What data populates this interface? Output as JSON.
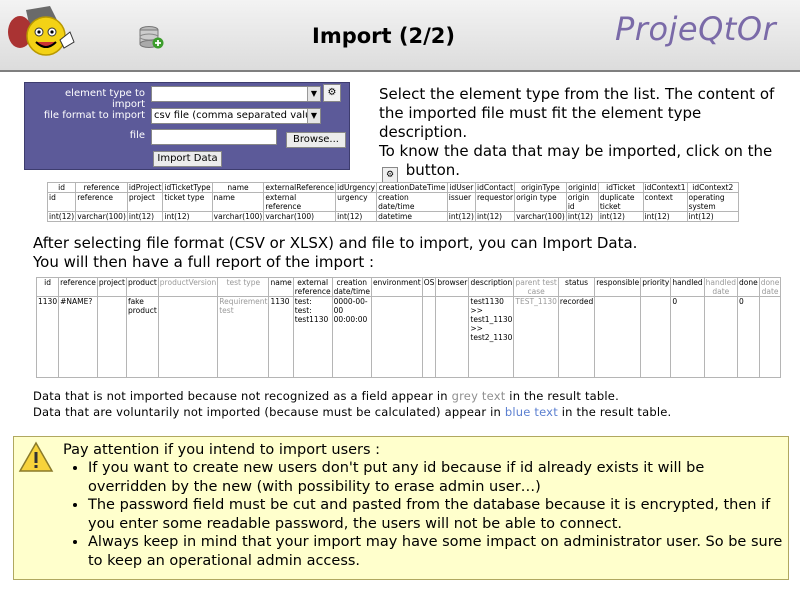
{
  "header": {
    "title": "Import (2/2)",
    "brand": "ProjeQtOr"
  },
  "form": {
    "element_label": "element type to import",
    "element_value": "",
    "format_label": "file format to import",
    "format_value": "csv file (comma separated valu",
    "file_label": "file",
    "browse_label": "Browse...",
    "import_label": "Import Data"
  },
  "description": {
    "line1": "Select the element type from the list. The content of the imported file must fit the element type description.",
    "line2_pre": "To know the data that may be imported, click on the",
    "line2_post": "button."
  },
  "type_table": {
    "columns": [
      "id",
      "reference",
      "idProject",
      "idTicketType",
      "name",
      "externalReference",
      "idUrgency",
      "creationDateTime",
      "idUser",
      "idContact",
      "originType",
      "originId",
      "idTicket",
      "idContext1",
      "idContext2"
    ],
    "labels": [
      "id",
      "reference",
      "project",
      "ticket type",
      "name",
      "external reference",
      "urgency",
      "creation date/time",
      "issuer",
      "requestor",
      "origin type",
      "origin id",
      "duplicate ticket",
      "context",
      "operating system"
    ],
    "types": [
      "int(12)",
      "varchar(100)",
      "int(12)",
      "int(12)",
      "varchar(100)",
      "varchar(100)",
      "int(12)",
      "datetime",
      "int(12)",
      "int(12)",
      "varchar(100)",
      "int(12)",
      "int(12)",
      "int(12)",
      "int(12)"
    ]
  },
  "middle_text": {
    "line1": "After selecting file format (CSV or XLSX) and file to import, you can Import Data.",
    "line2": "You will then have a full report of the import :"
  },
  "result_table": {
    "columns": [
      "id",
      "reference",
      "project",
      "product",
      "productVersion",
      "test type",
      "name",
      "external reference",
      "creation date/time",
      "environment",
      "OS",
      "browser",
      "description",
      "parent test case",
      "status",
      "responsible",
      "priority",
      "handled",
      "handled date",
      "done",
      "done date"
    ],
    "grey_columns": [
      4,
      5,
      13,
      18,
      20
    ],
    "row": [
      "1130",
      "#NAME?",
      "",
      "fake product",
      "",
      "Requirement test",
      "1130",
      "test: test: test1130",
      "0000-00-00 00:00:00",
      "",
      "",
      "",
      "test1130 >> test1_1130 >> test2_1130",
      "TEST_1130",
      "recorded",
      "",
      "",
      "0",
      "",
      "0",
      ""
    ]
  },
  "notes": {
    "grey_pre": "Data that is not imported because not recognized as a field appear in",
    "grey_word": "grey text",
    "grey_post": "in the result table.",
    "blue_pre": "Data that are voluntarily not imported (because must be calculated) appear in",
    "blue_word": "blue text",
    "blue_post": "in the result table."
  },
  "warning": {
    "title": "Pay attention if you intend to import users :",
    "items": [
      "If you want to create new users don't put any id because if id already exists it will be overridden by the new (with possibility to erase admin user…)",
      "The password field must be cut and pasted from the database because it is encrypted, then if you enter some readable password, the users will not be able to connect.",
      "Always keep in mind that your import may have some impact on administrator user. So be sure to keep an operational admin access."
    ]
  },
  "colors": {
    "form_bg": "#5c5a99",
    "brand": "#7a6aa8",
    "warning_bg": "#ffffcc",
    "grey_text": "#909090",
    "blue_text": "#5b7fd0"
  }
}
